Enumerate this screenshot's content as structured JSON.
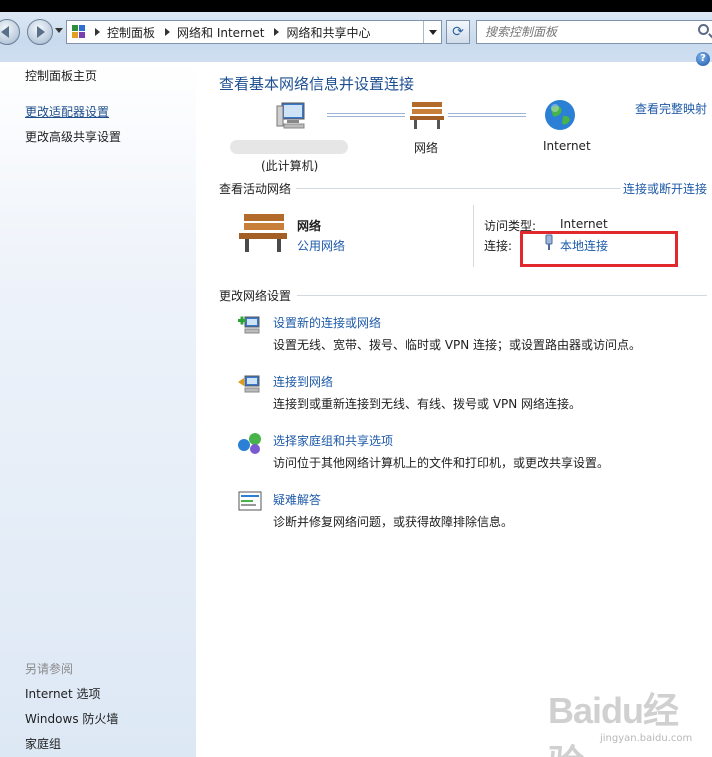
{
  "address_bar": {
    "breadcrumbs": [
      "控制面板",
      "网络和 Internet",
      "网络和共享中心"
    ],
    "refresh_icon": "refresh-icon",
    "search_placeholder": "搜索控制面板"
  },
  "sidebar": {
    "home": "控制面板主页",
    "links": [
      "更改适配器设置",
      "更改高级共享设置"
    ],
    "see_also_heading": "另请参阅",
    "see_also": [
      "Internet 选项",
      "Windows 防火墙",
      "家庭组"
    ]
  },
  "main": {
    "help_label": "?",
    "title": "查看基本网络信息并设置连接",
    "view_full_map": "查看完整映射",
    "map": {
      "computer_label": "(此计算机)",
      "network_label": "网络",
      "internet_label": "Internet"
    },
    "active": {
      "heading": "查看活动网络",
      "connect_link": "连接或断开连接",
      "network_name": "网络",
      "network_type": "公用网络",
      "access_type_label": "访问类型:",
      "access_type_value": "Internet",
      "connections_label": "连接:",
      "connections_value": "本地连接"
    },
    "change": {
      "heading": "更改网络设置",
      "tasks": [
        {
          "title": "设置新的连接或网络",
          "desc": "设置无线、宽带、拨号、临时或 VPN 连接；或设置路由器或访问点。"
        },
        {
          "title": "连接到网络",
          "desc": "连接到或重新连接到无线、有线、拨号或 VPN 网络连接。"
        },
        {
          "title": "选择家庭组和共享选项",
          "desc": "访问位于其他网络计算机上的文件和打印机，或更改共享设置。"
        },
        {
          "title": "疑难解答",
          "desc": "诊断并修复网络问题，或获得故障排除信息。"
        }
      ]
    }
  },
  "watermark": {
    "logo": "Baidu经验",
    "url": "jingyan.baidu.com"
  },
  "colors": {
    "link": "#1e5aa8",
    "title": "#1c4f92",
    "highlight": "#e0282d"
  }
}
